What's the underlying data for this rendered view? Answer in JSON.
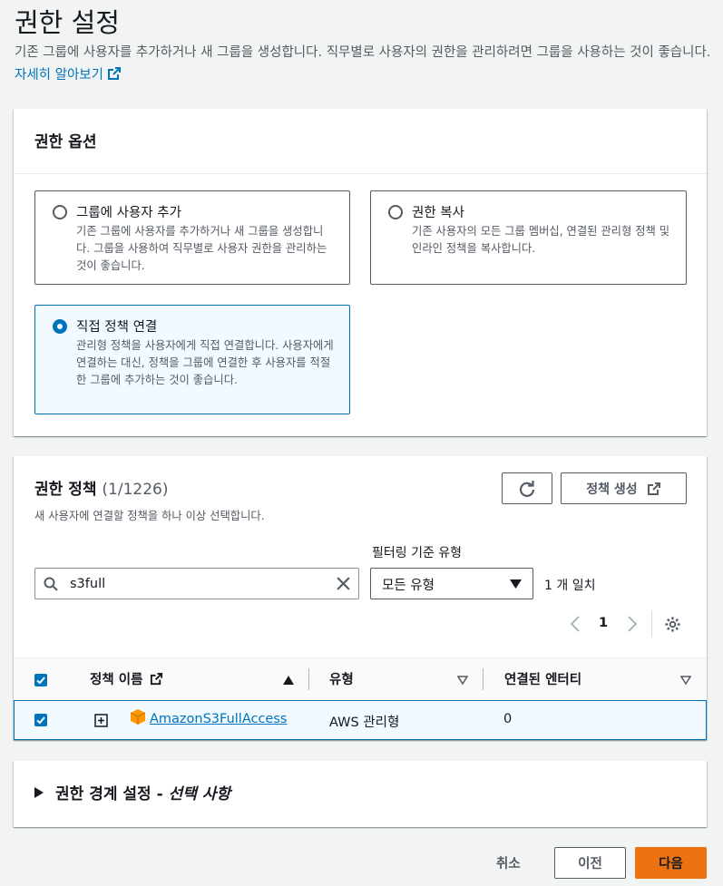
{
  "header": {
    "title": "권한 설정",
    "description": "기존 그룹에 사용자를 추가하거나 새 그룹을 생성합니다. 직무별로 사용자의 권한을 관리하려면 그룹을 사용하는 것이 좋습니다.",
    "learn_more": "자세히 알아보기"
  },
  "permission_options": {
    "title": "권한 옵션",
    "options": [
      {
        "label": "그룹에 사용자 추가",
        "description": "기존 그룹에 사용자를 추가하거나 새 그룹을 생성합니다. 그룹을 사용하여 직무별로 사용자 권한을 관리하는 것이 좋습니다.",
        "selected": false
      },
      {
        "label": "권한 복사",
        "description": "기존 사용자의 모든 그룹 멤버십, 연결된 관리형 정책 및 인라인 정책을 복사합니다.",
        "selected": false
      },
      {
        "label": "직접 정책 연결",
        "description": "관리형 정책을 사용자에게 직접 연결합니다. 사용자에게 연결하는 대신, 정책을 그룹에 연결한 후 사용자를 적절한 그룹에 추가하는 것이 좋습니다.",
        "selected": true
      }
    ]
  },
  "policies": {
    "title": "권한 정책",
    "count": "(1/1226)",
    "description": "새 사용자에 연결할 정책을 하나 이상 선택합니다.",
    "create_policy": "정책 생성",
    "filter_label": "필터링 기준 유형",
    "search_value": "s3full",
    "filter_type": "모든 유형",
    "match_count": "1 개 일치",
    "page": "1",
    "columns": {
      "name": "정책 이름",
      "type": "유형",
      "entities": "연결된 엔터티"
    },
    "rows": [
      {
        "name": "AmazonS3FullAccess",
        "type": "AWS 관리형",
        "entities": "0",
        "checked": true
      }
    ]
  },
  "boundary": {
    "title": "권한 경계 설정 - ",
    "optional": "선택 사항"
  },
  "footer": {
    "cancel": "취소",
    "previous": "이전",
    "next": "다음"
  },
  "colors": {
    "accent": "#0073bb",
    "primary_button": "#ec7211",
    "aws_orange": "#ff9900"
  }
}
